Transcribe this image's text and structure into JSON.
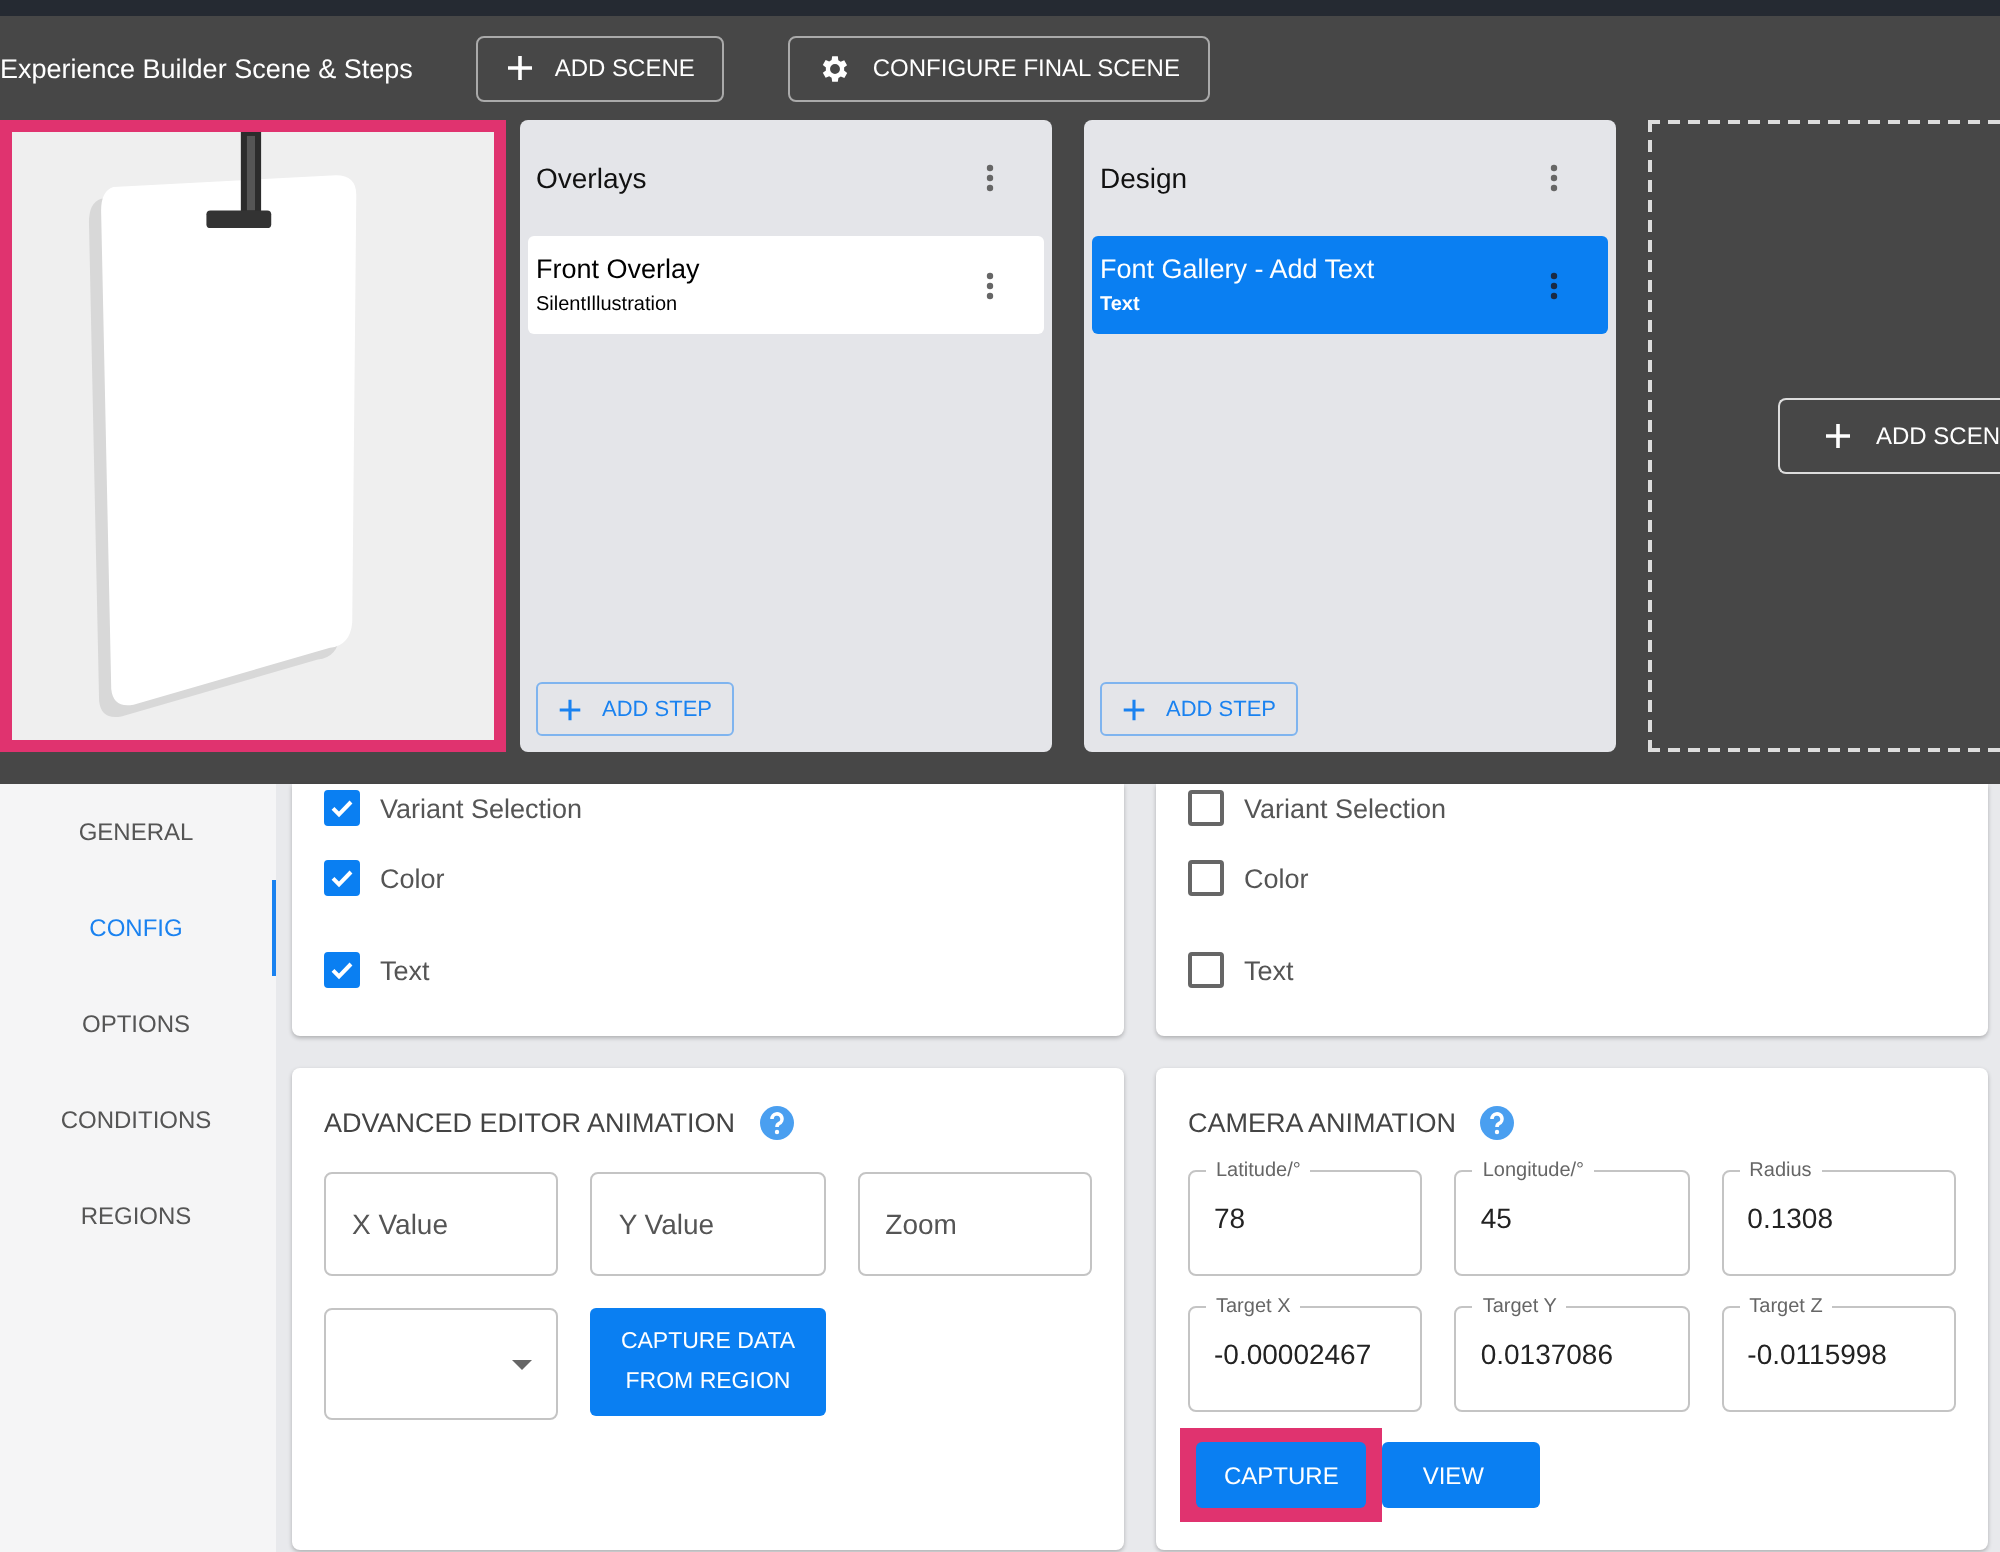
{
  "header": {
    "title": "Experience Builder Scene & Steps",
    "buttons": [
      {
        "label": "ADD SCENE"
      },
      {
        "label": "CONFIGURE FINAL SCENE"
      }
    ]
  },
  "preview": {
    "kind": "picture",
    "highlighted": true
  },
  "scenes": [
    {
      "title": "Overlays",
      "steps": [
        {
          "title": "Front Overlay",
          "subtitle": "SilentIllustration",
          "selected": false
        }
      ],
      "add_step": "ADD STEP"
    },
    {
      "title": "Design",
      "steps": [
        {
          "title": "Font Gallery - Add Text",
          "subtitle": "Text",
          "selected": true
        }
      ],
      "add_step": "ADD STEP"
    }
  ],
  "new_scene": {
    "button": "ADD SCEN"
  },
  "sidebar": {
    "items": [
      {
        "label": "GENERAL",
        "selected": false
      },
      {
        "label": "CONFIG",
        "selected": true
      },
      {
        "label": "OPTIONS",
        "selected": false
      },
      {
        "label": "CONDITIONS",
        "selected": false
      },
      {
        "label": "REGIONS",
        "selected": false
      }
    ]
  },
  "option_cards": [
    {
      "items": [
        {
          "label": "Variant Selection",
          "checked": true
        },
        {
          "label": "Color",
          "checked": true
        },
        {
          "label": "Text",
          "checked": true
        }
      ]
    },
    {
      "items": [
        {
          "label": "Variant Selection",
          "checked": false
        },
        {
          "label": "Color",
          "checked": false
        },
        {
          "label": "Text",
          "checked": false
        }
      ]
    }
  ],
  "advanced_editor": {
    "title": "ADVANCED EDITOR ANIMATION",
    "fields": [
      {
        "placeholder": "X Value"
      },
      {
        "placeholder": "Y Value"
      },
      {
        "placeholder": "Zoom"
      }
    ],
    "button_lines": [
      "CAPTURE DATA",
      "FROM REGION"
    ]
  },
  "camera": {
    "title": "CAMERA ANIMATION",
    "fields": [
      {
        "label": "Latitude/°",
        "value": "78"
      },
      {
        "label": "Longitude/°",
        "value": "45"
      },
      {
        "label": "Radius",
        "value": "0.1308"
      },
      {
        "label": "Target X",
        "value": "-0.00002467"
      },
      {
        "label": "Target Y",
        "value": "0.0137086"
      },
      {
        "label": "Target Z",
        "value": "-0.0115998"
      }
    ],
    "buttons": [
      {
        "label": "CAPTURE",
        "highlighted": true
      },
      {
        "label": "VIEW",
        "highlighted": false
      }
    ]
  }
}
